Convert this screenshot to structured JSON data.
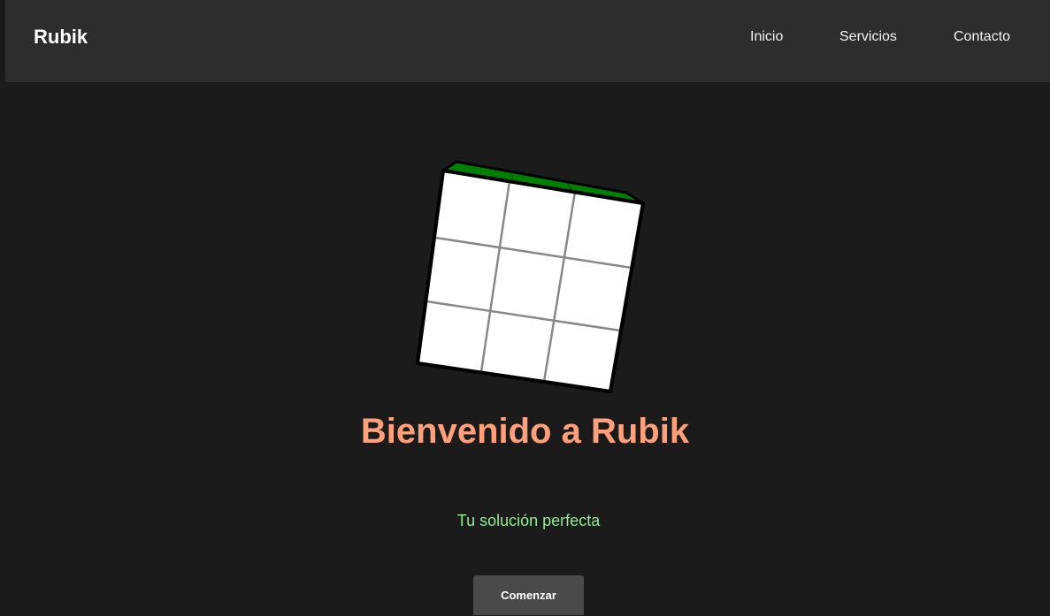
{
  "navbar": {
    "brand": "Rubik",
    "links": [
      {
        "label": "Inicio"
      },
      {
        "label": "Servicios"
      },
      {
        "label": "Contacto"
      }
    ]
  },
  "hero": {
    "title": "Bienvenido a Rubik",
    "subtitle": "Tu solución perfecta",
    "button_label": "Comenzar"
  },
  "cube": {
    "top_color": "#008000",
    "face_color": "#ffffff",
    "grid_color": "#888888",
    "edge_color": "#000000"
  },
  "colors": {
    "background": "#1b1b1b",
    "navbar": "#2d2d2d",
    "title": "#ffa07a",
    "subtitle": "#90ee90",
    "button": "#4a4a4a"
  }
}
